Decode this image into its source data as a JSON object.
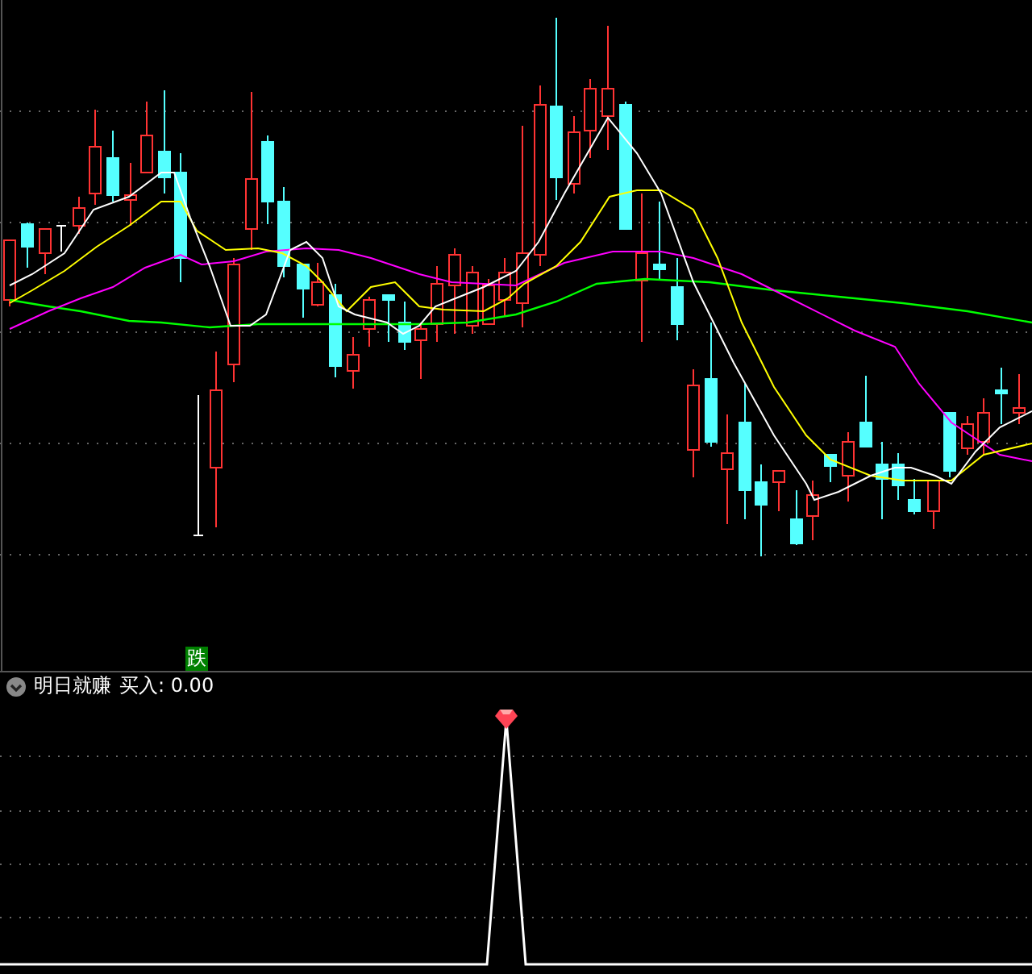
{
  "signal_marker": {
    "text": "跌"
  },
  "indicator_header": {
    "name": "明日就赚",
    "reading": "买入: 0.00"
  }
}
